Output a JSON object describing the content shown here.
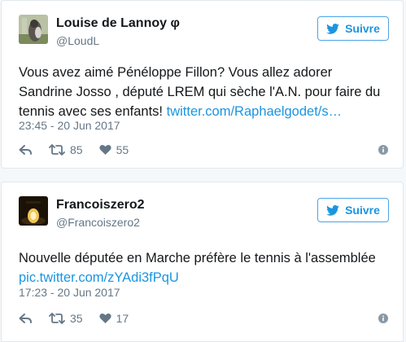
{
  "tweets": [
    {
      "author_name": "Louise de Lannoy φ",
      "author_handle": "@LoudL",
      "follow_label": "Suivre",
      "text": "Vous avez aimé Pénéloppe Fillon? Vous allez adorer Sandrine Josso , député LREM qui sèche l'A.N. pour faire du tennis avec ses enfants! ",
      "link": "twitter.com/Raphaelgodet/s…",
      "date": "23:45 - 20 Jun 2017",
      "retweets": "85",
      "likes": "55"
    },
    {
      "author_name": "Francoiszero2",
      "author_handle": "@Francoiszero2",
      "follow_label": "Suivre",
      "text": "Nouvelle députée en Marche préfère le tennis à l'assemblée",
      "link": "pic.twitter.com/zYAdi3fPqU",
      "date": "17:23 - 20 Jun 2017",
      "retweets": "35",
      "likes": "17"
    }
  ],
  "icons": {
    "follow": "twitter-bird-icon",
    "reply": "reply-icon",
    "retweet": "retweet-icon",
    "like": "heart-icon",
    "info": "info-icon"
  },
  "colors": {
    "link": "#1b95e0",
    "muted": "#657786",
    "border": "#e1e8ed"
  }
}
